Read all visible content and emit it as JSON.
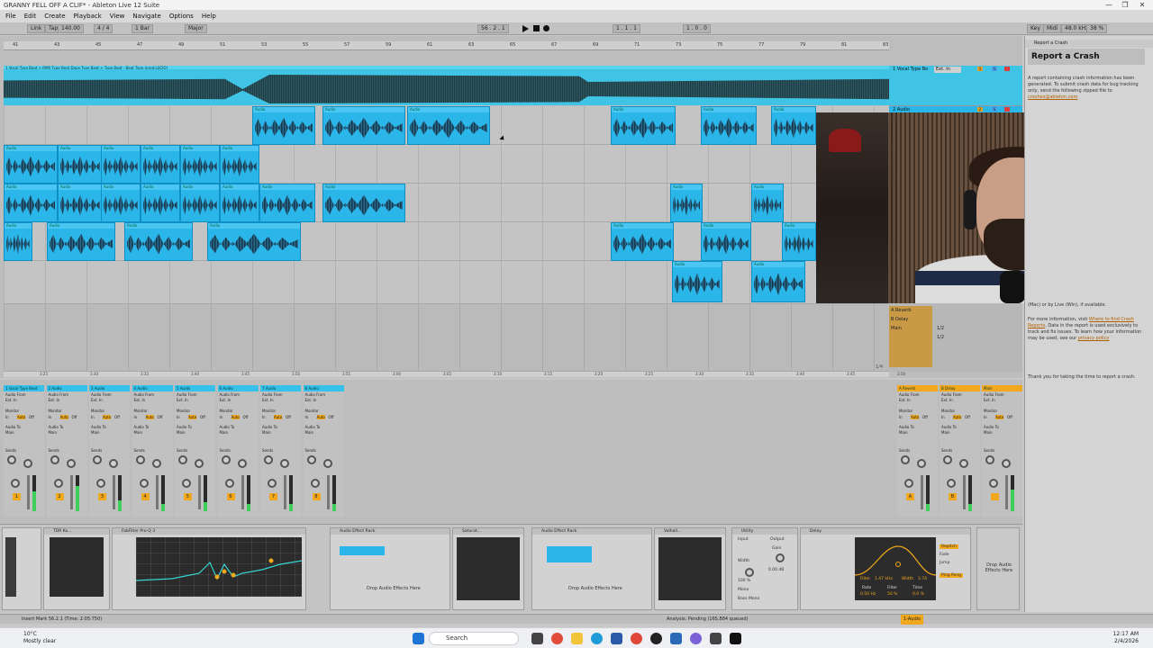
{
  "window": {
    "title": "GRANNY FELL OFF A CLIF* - Ableton Live 12 Suite",
    "controls": [
      "—",
      "❐",
      "✕"
    ]
  },
  "menu": [
    "File",
    "Edit",
    "Create",
    "Playback",
    "View",
    "Navigate",
    "Options",
    "Help"
  ],
  "control_bar": {
    "link": "Link",
    "tap": "Tap",
    "tempo": "140.00",
    "signature": "4 / 4",
    "quantize": "1 Bar",
    "key": "Major",
    "position": "56 . 2 . 1",
    "loop_start": "1 . 1 . 1",
    "loop_len": "1 . 0 . 0",
    "key_btn": "Key",
    "midi_btn": "Midi",
    "cpu": "38 %",
    "disk": "48.0 kHz"
  },
  "arrangement": {
    "master_header": "1 Vocal Type Beat > RMX Type Beat Dope Type Beat > Type Beat - Beat Type (prod.LUCIO)",
    "ruler_marks": [
      "41",
      "43",
      "45",
      "47",
      "49",
      "51",
      "53",
      "55",
      "57",
      "59",
      "61",
      "63",
      "65",
      "67",
      "69",
      "71",
      "73",
      "75",
      "77",
      "79",
      "81",
      "83"
    ],
    "bottom_ruler": [
      "1:25",
      "1:30",
      "1:35",
      "1:40",
      "1:45",
      "1:50",
      "1:55",
      "2:00",
      "2:05",
      "2:10",
      "2:15",
      "2:20",
      "2:25",
      "2:30",
      "2:35",
      "2:40",
      "2:45",
      "2:50"
    ],
    "page_counter": "1/4",
    "track_names": [
      "1 Vocal Type Bo",
      "2 Audio",
      "3 Audio",
      "4 Audio",
      "5 Audio",
      "6 Audio",
      "7 Audio",
      "8 Audio"
    ],
    "io_master": "Ext. In",
    "returns": [
      "A Reverb",
      "B Delay",
      "Main"
    ],
    "sends": [
      "1/2",
      "1/2"
    ]
  },
  "clips": {
    "label": "Audio"
  },
  "crash_panel": {
    "tab": "Report a Crash",
    "title": "Report a Crash",
    "para1": "A report containing crash information has been generated. To submit crash data for bug tracking only, send the following zipped file to",
    "email": "crashes@ableton.com",
    "para2a": "(Mac) or by Live (Win), if available.",
    "para2b": "For more information, visit",
    "link1": "Where to find Crash Reports",
    "para2c": ". Data in the report is used exclusively to track and fix issues. To learn how your information may be used, see our",
    "link2": "privacy policy",
    "para3": "Thank you for taking the time to report a crash."
  },
  "mixer": {
    "audio_from": "Audio From",
    "ext_in": "Ext. In",
    "monitor": "Monitor",
    "monitor_opts": [
      "In",
      "Auto",
      "Off"
    ],
    "audio_to": "Audio To",
    "main": "Main",
    "sends": "Sends",
    "strips": [
      {
        "name": "1 Vocal Type Beat",
        "num": "1",
        "level": 0.55
      },
      {
        "name": "2 Audio",
        "num": "2",
        "level": 0.7
      },
      {
        "name": "3 Audio",
        "num": "3",
        "level": 0.3
      },
      {
        "name": "4 Audio",
        "num": "4",
        "level": 0.2
      },
      {
        "name": "5 Audio",
        "num": "5",
        "level": 0.25
      },
      {
        "name": "6 Audio",
        "num": "6",
        "level": 0.2
      },
      {
        "name": "7 Audio",
        "num": "7",
        "level": 0.2
      },
      {
        "name": "8 Audio",
        "num": "8",
        "level": 0.2
      }
    ],
    "returns": [
      {
        "name": "A Reverb",
        "num": "A",
        "level": 0.2
      },
      {
        "name": "B Delay",
        "num": "B",
        "level": 0.2
      },
      {
        "name": "Main",
        "num": "",
        "level": 0.6
      }
    ],
    "cue_out": "Cue Out",
    "main_out": "Main Out"
  },
  "devices": {
    "tdr": "TDR Ko...",
    "eq": "FabFilter Pro-Q 3",
    "rack1": "Audio Effect Rack",
    "saturator": "Saturat...",
    "rack2": "Audio Effect Rack",
    "valhalla": "Valhall...",
    "utility": "Utility",
    "delay": "Delay",
    "drop_text": "Drop Audio Effects Here",
    "delay_params": {
      "filter": "Filter",
      "freq": "1.47 kHz",
      "width": "Width",
      "width_val": "3.74",
      "rate": "Rate",
      "rate_val": "0.50 Hz",
      "filter_amt": "Filter",
      "filter_pct": "50 %",
      "time": "Time",
      "time_pct": "0.0 %"
    },
    "delay_modes": [
      "Repitch",
      "Fade",
      "Jump"
    ],
    "delay_ping": "Ping Pong",
    "utility_labels": [
      "Input",
      "Output",
      "Gain",
      "Width",
      "Mono",
      "Bass Mono"
    ],
    "utility_vals": [
      "0.00 dB",
      "100 %"
    ]
  },
  "status": {
    "left": "Insert Mark 56.2.1 (Time: 2:05:750)",
    "center": "Analysis: Pending (165,884 queued)",
    "right_track": "1-Audio"
  },
  "taskbar": {
    "weather_temp": "10°C",
    "weather_desc": "Mostly clear",
    "search": "Search",
    "time": "12:17 AM",
    "date": "2/4/2026"
  }
}
